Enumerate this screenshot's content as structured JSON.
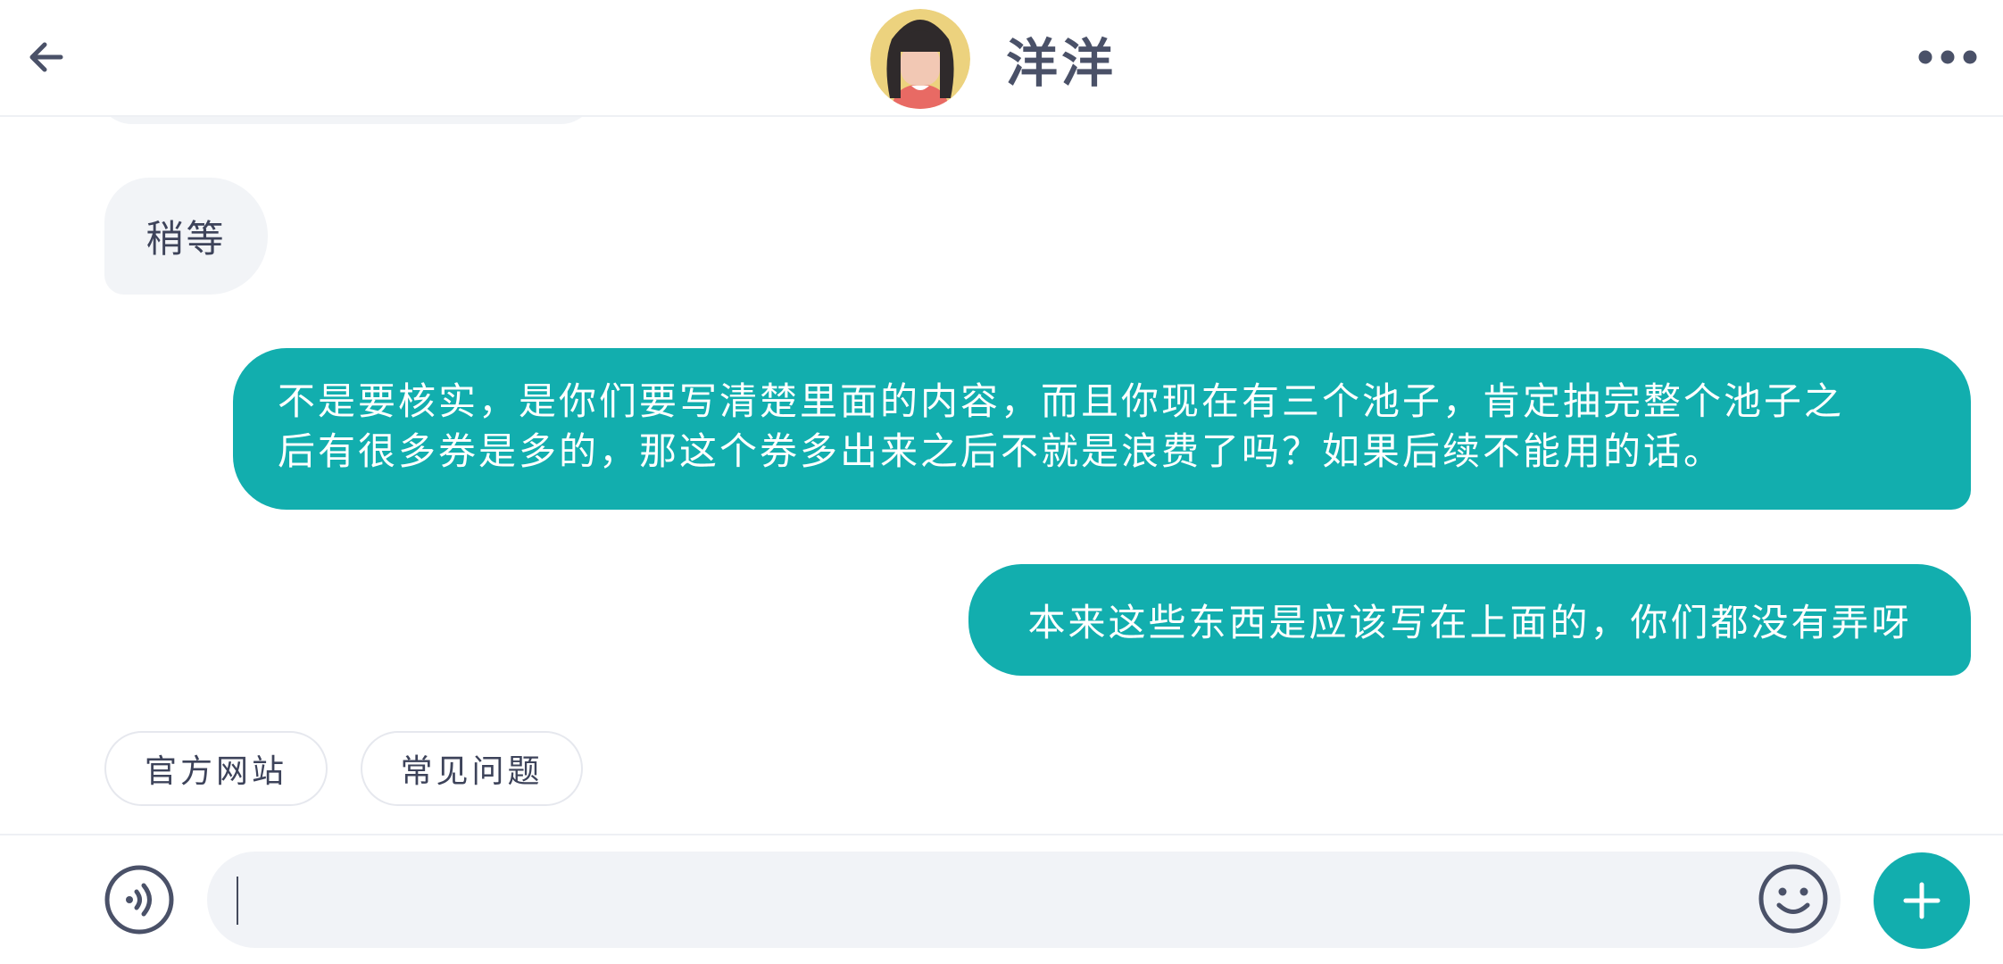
{
  "header": {
    "contact_name": "洋洋",
    "back_icon": "arrow-left-icon",
    "more_icon": "more-horizontal-icon"
  },
  "messages": [
    {
      "direction": "incoming",
      "text": "稍等"
    },
    {
      "direction": "outgoing",
      "lines": [
        "不是要核实，是你们要写清楚里面的内容，而且你现在有三个池子，肯定抽完整个池子之",
        "后有很多券是多的，那这个券多出来之后不就是浪费了吗？如果后续不能用的话。"
      ]
    },
    {
      "direction": "outgoing",
      "text": "本来这些东西是应该写在上面的，你们都没有弄呀"
    }
  ],
  "quick_replies": [
    "官方网站",
    "常见问题"
  ],
  "input": {
    "value": "",
    "placeholder": "",
    "voice_icon": "voice-icon",
    "emoji_icon": "emoji-icon",
    "add_icon": "plus-icon"
  },
  "colors": {
    "accent": "#12aeae",
    "incoming_bubble": "#f2f4f7",
    "title_text": "#4a5168"
  }
}
